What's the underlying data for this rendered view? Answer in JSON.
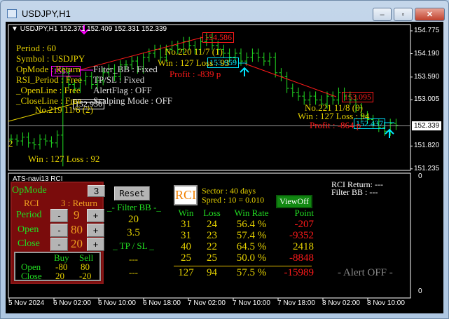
{
  "window": {
    "title": "USDJPY,H1",
    "minimize": "–",
    "maximize": "▫",
    "close": "✕"
  },
  "chart": {
    "header": "USDJPY,H1  152.371 152.409 152.331 152.339",
    "price_ticks": [
      "154.775",
      "154.190",
      "153.590",
      "153.005",
      "151.820",
      "151.235"
    ],
    "price_tick_values": [
      154.775,
      154.19,
      153.59,
      153.005,
      151.82,
      151.235
    ],
    "current_price": "152.339",
    "current_price_value": 152.339,
    "bar_closes": [
      152.0,
      151.95,
      152.05,
      151.9,
      151.85,
      152.0,
      151.95,
      151.9,
      152.1,
      153.7,
      153.4,
      153.3,
      153.5,
      153.6,
      153.4,
      153.5,
      153.7,
      153.8,
      153.6,
      153.9,
      153.9,
      154.0,
      153.8,
      154.1,
      154.2,
      154.3,
      154.1,
      154.3,
      154.4,
      154.3,
      154.5,
      154.4,
      154.3,
      154.5,
      154.6,
      154.4,
      154.3,
      154.2,
      154.1,
      154.2,
      154.0,
      154.1,
      154.2,
      154.1,
      154.0,
      154.1,
      153.7,
      153.6,
      153.3,
      153.2,
      153.1,
      153.0,
      153.1,
      153.0,
      152.9,
      153.1,
      153.0,
      153.2,
      153.1,
      153.0,
      152.8,
      152.6,
      152.5,
      152.4,
      152.3,
      152.2,
      152.4,
      152.35
    ],
    "labels": {
      "l154586": "154.586",
      "l153959": "153.959",
      "l152930": "152.930",
      "l153095": "153.095",
      "l152437": "152.437",
      "magenta": "153.?"
    },
    "info": {
      "period": "Period : 60",
      "symbol": "Symbol : USDJPY",
      "opmode": "OpMode : Return",
      "rsi": "RSI_Period : Free",
      "openline": "_OpenLine : Free",
      "closeline": "_CloseLine : Free",
      "filter": "Filter_BB : Fixed",
      "tpsl": "TP/SL : Fixed",
      "alert": "AlertFlag : OFF",
      "scalp": "Scalping Mode : OFF"
    },
    "trades": [
      {
        "no": "No.219   11/6 (2)"
      },
      {
        "no": "No.220   11/7 (1)",
        "wl": "Win : 127   Loss : 93",
        "profit": "Profit : -839 p"
      },
      {
        "no": "No.221   11/8 (0)",
        "wl": "Win : 127   Loss : 94",
        "profit": "Profit : -864 p"
      }
    ],
    "left_partial": "2",
    "left_wl": "Win : 127   Loss : 92"
  },
  "indicator": {
    "name": "ATS-navi13  RCI",
    "axis_top": "0",
    "axis_bottom": "0",
    "opmode_label": "OpMode",
    "opmode_value": "3",
    "rci_label": "RCI",
    "rci_mode": "3 : Return",
    "rows": [
      {
        "label": "Period",
        "value": "9"
      },
      {
        "label": "Open",
        "value": "80"
      },
      {
        "label": "Close",
        "value": "20"
      }
    ],
    "minus": "-",
    "plus": "+",
    "bs": {
      "buy": "Buy",
      "sell": "Sell",
      "open": "Open",
      "close": "Close",
      "open_buy": "-80",
      "open_sell": "80",
      "close_buy": "20",
      "close_sell": "-20"
    },
    "reset": "Reset",
    "filter_title": "_- Filter BB -_",
    "filter_1": "20",
    "filter_2": "3.5",
    "tpsl_title": "_ TP  /  SL _",
    "tp": "---",
    "sl": "---",
    "logo": "RCI",
    "sector": "Sector : 40 days",
    "spred": "Spred : 10 = 0.010",
    "viewoff": "ViewOff",
    "headers": [
      "Win",
      "Loss",
      "Win Rate",
      "Point"
    ],
    "stats": [
      [
        "31",
        "24",
        "56.4 %",
        "-207"
      ],
      [
        "31",
        "23",
        "57.4 %",
        "-9352"
      ],
      [
        "40",
        "22",
        "64.5 %",
        "2418"
      ],
      [
        "25",
        "25",
        "50.0 %",
        "-8848"
      ]
    ],
    "total": [
      "127",
      "94",
      "57.5 %",
      "-15989"
    ],
    "rci_return": "RCI Return: ---",
    "filter_bb": "Filter BB   : ---",
    "alert": "- Alert OFF -"
  },
  "time_axis": [
    "5 Nov 2024",
    "6 Nov 02:00",
    "6 Nov 10:00",
    "6 Nov 18:00",
    "7 Nov 02:00",
    "7 Nov 10:00",
    "7 Nov 18:00",
    "8 Nov 02:00",
    "8 Nov 10:00"
  ]
}
